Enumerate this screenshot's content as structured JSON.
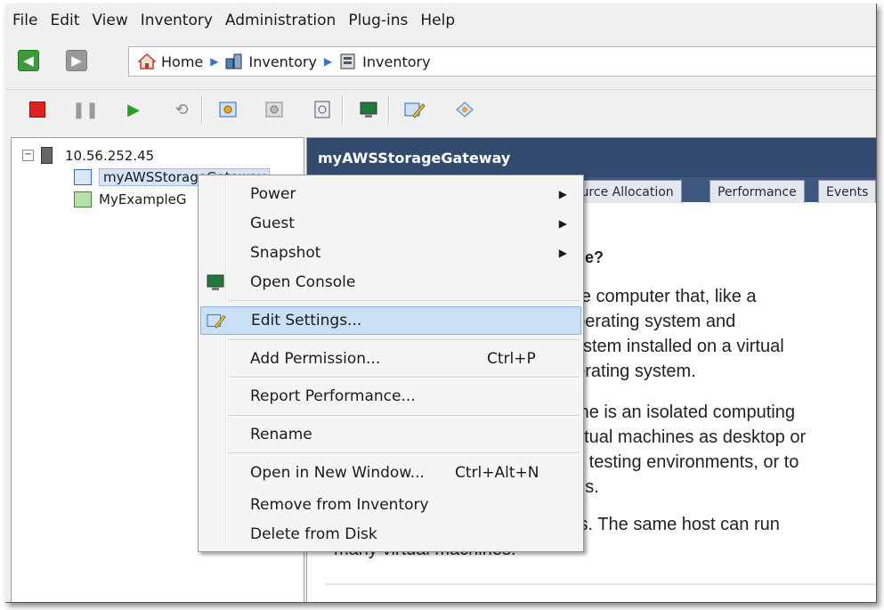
{
  "menubar": [
    "File",
    "Edit",
    "View",
    "Inventory",
    "Administration",
    "Plug-ins",
    "Help"
  ],
  "breadcrumb": {
    "home": "Home",
    "item1": "Inventory",
    "item2": "Inventory"
  },
  "tree": {
    "host": "10.56.252.45",
    "vm1": "myAWSStorageGateway",
    "vm2": "MyExampleG"
  },
  "content": {
    "title": "myAWSStorageGateway",
    "tabs": [
      "ource Allocation",
      "Performance",
      "Events"
    ],
    "heading_fragment": "e?",
    "lines": [
      "are computer that, like a",
      "operating system and",
      "system installed on a virtual",
      "perating system.",
      "hine is an isolated computing",
      "virtual machines as desktop or",
      "as testing environments, or to",
      "ons.",
      "sts. The same host can run",
      "many virtual machines."
    ]
  },
  "context_menu": {
    "items": [
      {
        "label": "Power",
        "submenu": true
      },
      {
        "label": "Guest",
        "submenu": true
      },
      {
        "label": "Snapshot",
        "submenu": true
      },
      {
        "label": "Open Console"
      },
      {
        "label": "Edit Settings..."
      },
      {
        "label": "Add Permission...",
        "shortcut": "Ctrl+P"
      },
      {
        "label": "Report Performance..."
      },
      {
        "label": "Rename"
      },
      {
        "label": "Open in New Window...",
        "shortcut": "Ctrl+Alt+N"
      },
      {
        "label": "Remove from Inventory"
      },
      {
        "label": "Delete from Disk"
      }
    ],
    "submenu_arrow": "▶"
  },
  "colors": {
    "header_bg": "#324a6e",
    "highlight": "#c9e0f7",
    "stop": "#e02020",
    "play": "#22a022"
  }
}
